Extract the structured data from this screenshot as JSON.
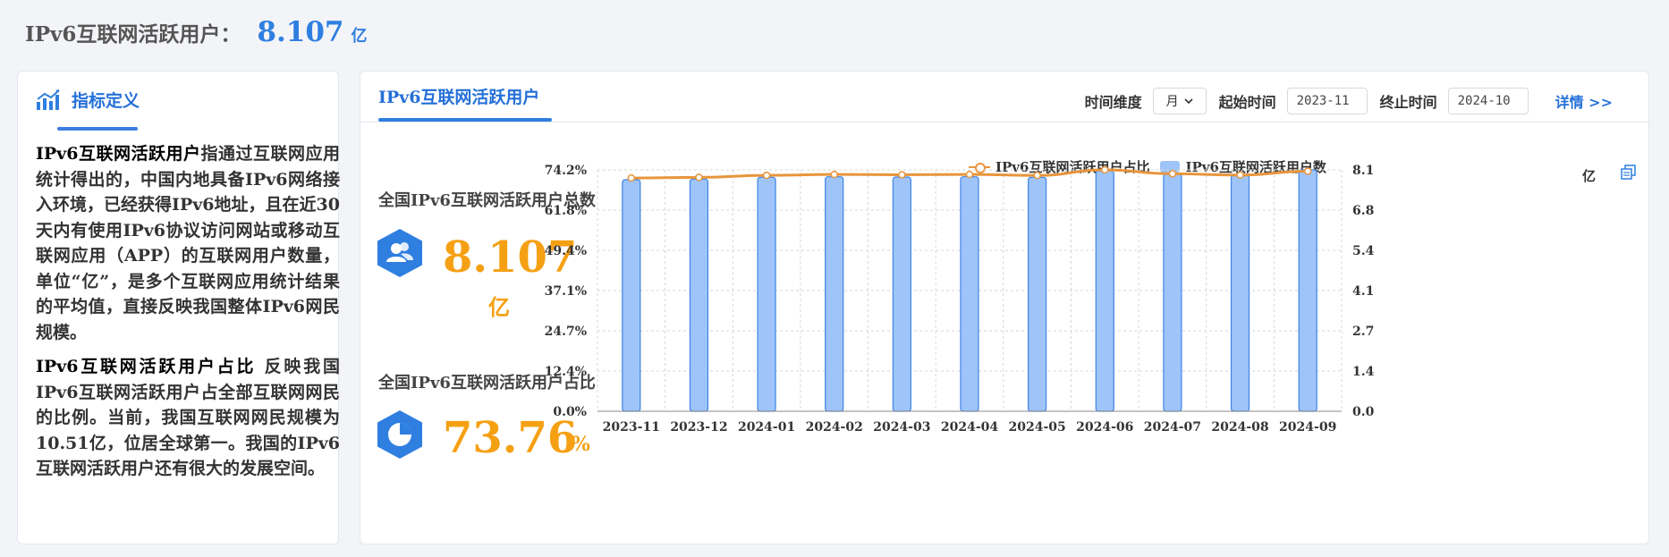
{
  "header": {
    "label": "IPv6互联网活跃用户：",
    "value": "8.107",
    "unit": "亿"
  },
  "definition": {
    "title": "指标定义",
    "icon": "trend-chart-icon",
    "p1_term": "IPv6互联网活跃用户",
    "p1_text": "指通过互联网应用统计得出的，中国内地具备IPv6网络接入环境，已经获得IPv6地址，且在近30天内有使用IPv6协议访问网站或移动互联网应用（APP）的互联网用户数量，单位“亿”，是多个互联网应用统计结果的平均值，直接反映我国整体IPv6网民规模。",
    "p2_term": "IPv6互联网活跃用户占比",
    "p2_text": " 反映我国IPv6互联网活跃用户占全部互联网网民的比例。当前，我国互联网网民规模为10.51亿，位居全球第一。我国的IPv6互联网活跃用户还有很大的发展空间。"
  },
  "panel": {
    "tab": "IPv6互联网活跃用户",
    "time_dimension_label": "时间维度",
    "time_dimension_value": "月",
    "start_label": "起始时间",
    "start_value": "2023-11",
    "end_label": "终止时间",
    "end_value": "2024-10",
    "detail_link": "详情 >>"
  },
  "stats": {
    "total_label": "全国IPv6互联网活跃用户总数",
    "total_value": "8.107",
    "total_unit": "亿",
    "total_icon": "users-icon",
    "ratio_label": "全国IPv6互联网活跃用户占比",
    "ratio_value": "73.76",
    "ratio_unit": "%",
    "ratio_icon": "pie-chart-icon"
  },
  "colors": {
    "accent_blue": "#2f7fe0",
    "value_orange": "#f5a013",
    "bar_fill": "#9ec4f9",
    "bar_stroke": "#3f84e6",
    "line": "#e8953c"
  },
  "chart_data": {
    "type": "bar",
    "categories": [
      "2023-11",
      "2023-12",
      "2024-01",
      "2024-02",
      "2024-03",
      "2024-04",
      "2024-05",
      "2024-06",
      "2024-07",
      "2024-08",
      "2024-09"
    ],
    "series": [
      {
        "name": "IPv6互联网活跃用户数",
        "type": "bar",
        "axis": "right",
        "values": [
          7.77,
          7.79,
          7.85,
          7.87,
          7.86,
          7.87,
          7.85,
          8.07,
          7.98,
          7.94,
          8.1
        ]
      },
      {
        "name": "IPv6互联网活跃用户占比",
        "type": "line",
        "axis": "left",
        "values": [
          71.7,
          71.9,
          72.5,
          72.8,
          72.7,
          72.8,
          72.5,
          74.2,
          73.0,
          72.6,
          73.8
        ]
      }
    ],
    "y_left": {
      "ticks": [
        "0.0%",
        "12.4%",
        "24.7%",
        "37.1%",
        "49.4%",
        "61.8%",
        "74.2%"
      ],
      "ylim": [
        0,
        74.2
      ]
    },
    "y_right": {
      "ticks": [
        "0.0",
        "1.4",
        "2.7",
        "4.1",
        "5.4",
        "6.8",
        "8.1"
      ],
      "ylim": [
        0,
        8.1
      ],
      "unit": "亿"
    },
    "legend": "top-center",
    "grid": true
  }
}
